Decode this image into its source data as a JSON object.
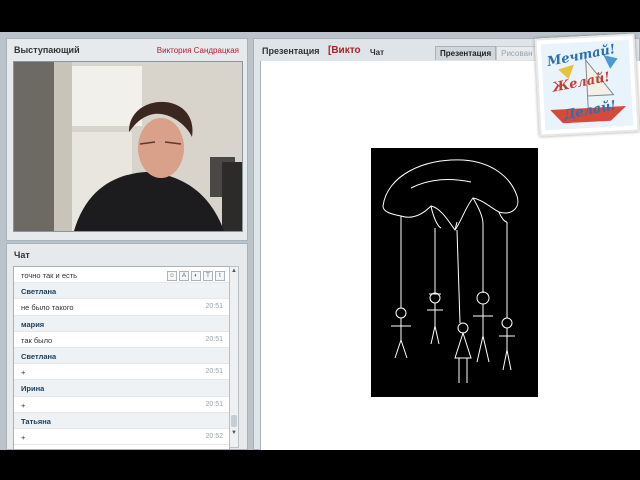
{
  "speaker_panel": {
    "title": "Выступающий",
    "speaker_name": "Виктория Сандрацкая"
  },
  "chat_panel": {
    "title": "Чат",
    "tool_icons": [
      "smile-icon",
      "font-icon",
      "color-icon",
      "text-size-icon",
      "text-size-small-icon"
    ],
    "messages": [
      {
        "kind": "text",
        "text": "точно так и есть",
        "time": ""
      },
      {
        "kind": "name",
        "text": "Светлана",
        "time": ""
      },
      {
        "kind": "text",
        "text": "не было такого",
        "time": "20:51"
      },
      {
        "kind": "name",
        "text": "мария",
        "time": ""
      },
      {
        "kind": "text",
        "text": "так было",
        "time": "20:51"
      },
      {
        "kind": "name",
        "text": "Светлана",
        "time": ""
      },
      {
        "kind": "text",
        "text": "+",
        "time": "20:51"
      },
      {
        "kind": "name",
        "text": "Ирина",
        "time": ""
      },
      {
        "kind": "text",
        "text": "+",
        "time": "20:51"
      },
      {
        "kind": "name",
        "text": "Татьяна",
        "time": ""
      },
      {
        "kind": "text",
        "text": "+",
        "time": "20:52"
      }
    ]
  },
  "presentation_panel": {
    "title": "Презентация",
    "speaker_name": "[Викто",
    "chat_tab_label": "Чат",
    "tabs": [
      {
        "label": "Презентация",
        "active": true
      },
      {
        "label": "Рисован",
        "active": false
      }
    ]
  },
  "logo": {
    "lines": [
      "Мечтай!",
      "Желай!",
      "Делай!"
    ]
  },
  "colors": {
    "accent_red": "#b0202a",
    "panel_bg": "#e6eaed",
    "frame_bg": "#b9c3c9"
  }
}
